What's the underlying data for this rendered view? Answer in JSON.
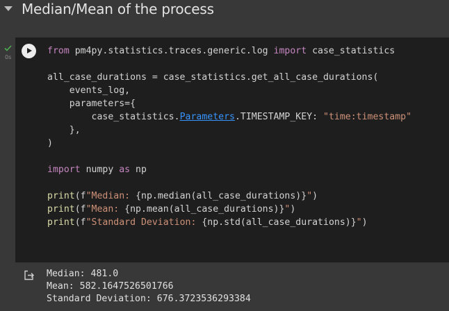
{
  "header": {
    "title": "Median/Mean of the process"
  },
  "cell": {
    "exec_time": "0s",
    "code": {
      "l1_from": "from",
      "l1_module": " pm4py.statistics.traces.generic.log ",
      "l1_import": "import",
      "l1_name": " case_statistics",
      "l2_var": "all_case_durations = case_statistics.get_all_case_durations(",
      "l3": "    events_log,",
      "l4": "    parameters={",
      "l5_obj": "        case_statistics.",
      "l5_link": "Parameters",
      "l5_key": ".TIMESTAMP_KEY: ",
      "l5_str": "\"time:timestamp\"",
      "l6": "    },",
      "l7": ")",
      "l8_import": "import",
      "l8_mid": " numpy ",
      "l8_as": "as",
      "l8_alias": " np",
      "p_fn": "print",
      "p1_open": "(f",
      "p1_str": "\"Median: ",
      "p1_expr": "{np.median(all_case_durations)}",
      "p1_close_str": "\"",
      "p1_close": ")",
      "p2_open": "(f",
      "p2_str": "\"Mean: ",
      "p2_expr": "{np.mean(all_case_durations)}",
      "p2_close_str": "\"",
      "p2_close": ")",
      "p3_open": "(f",
      "p3_str": "\"Standard Deviation: ",
      "p3_expr": "{np.std(all_case_durations)}",
      "p3_close_str": "\"",
      "p3_close": ")"
    }
  },
  "output": {
    "lines": [
      "Median: 481.0",
      "Mean: 582.1647526501766",
      "Standard Deviation: 676.3723536293384"
    ]
  }
}
